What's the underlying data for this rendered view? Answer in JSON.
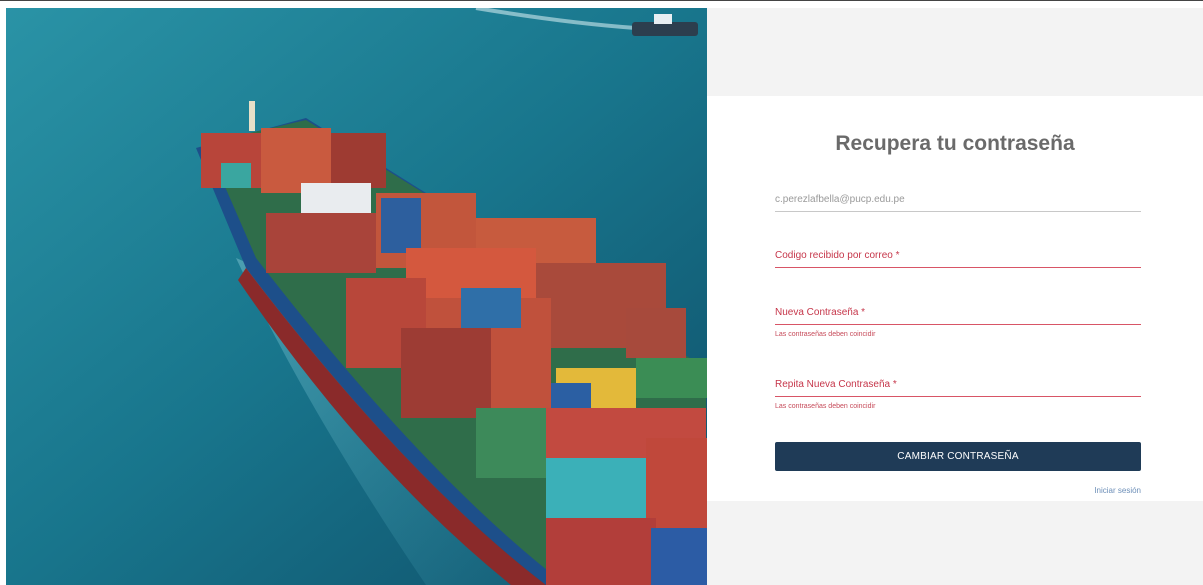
{
  "hero": {
    "image_description_icon": "cargo-ship-image"
  },
  "form": {
    "title": "Recupera tu contraseña",
    "email_value": "c.perezlafbella@pucp.edu.pe",
    "code_label": "Codigo recibido por correo *",
    "new_password_label": "Nueva Contraseña *",
    "new_password_hint": "Las contraseñas deben coincidir",
    "repeat_password_label": "Repita Nueva Contraseña *",
    "repeat_password_hint": "Las contraseñas deben coincidir",
    "submit_label": "CAMBIAR CONTRASEÑA",
    "login_link": "Iniciar sesión"
  },
  "colors": {
    "button": "#1f3b57",
    "error": "#c6364a",
    "link": "#6d8fb8",
    "title": "#6a6a6a"
  }
}
